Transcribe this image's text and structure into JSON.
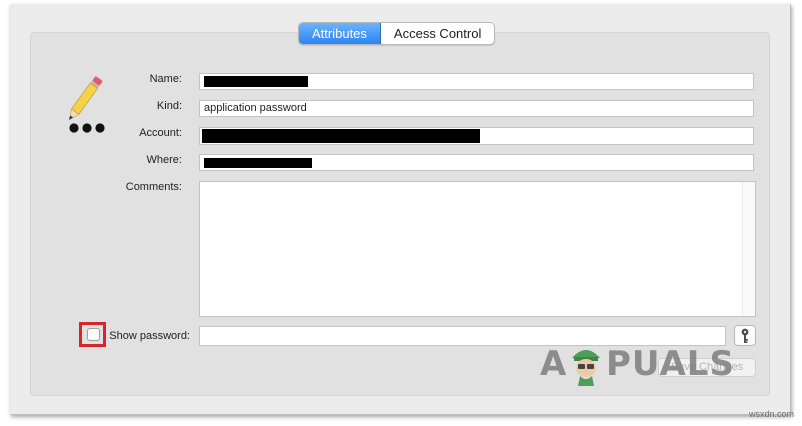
{
  "tabs": [
    {
      "label": "Attributes",
      "active": true
    },
    {
      "label": "Access Control",
      "active": false
    }
  ],
  "fields": {
    "name": {
      "label": "Name:",
      "redacted": true
    },
    "kind": {
      "label": "Kind:",
      "value": "application password"
    },
    "account": {
      "label": "Account:",
      "redacted": true
    },
    "where": {
      "label": "Where:",
      "redacted": true
    },
    "comments": {
      "label": "Comments:",
      "value": ""
    }
  },
  "show_password": {
    "label": "Show password:",
    "checked": false
  },
  "save_button": {
    "label": "Save Changes",
    "enabled": false
  },
  "watermark": {
    "left": "A",
    "right": "PUALS"
  },
  "footer": "wsxdn.com",
  "icons": {
    "item": "pencil-password-icon",
    "key": "key-icon"
  },
  "colors": {
    "tab_active": "#2a84f4",
    "highlight": "#d6262c"
  }
}
